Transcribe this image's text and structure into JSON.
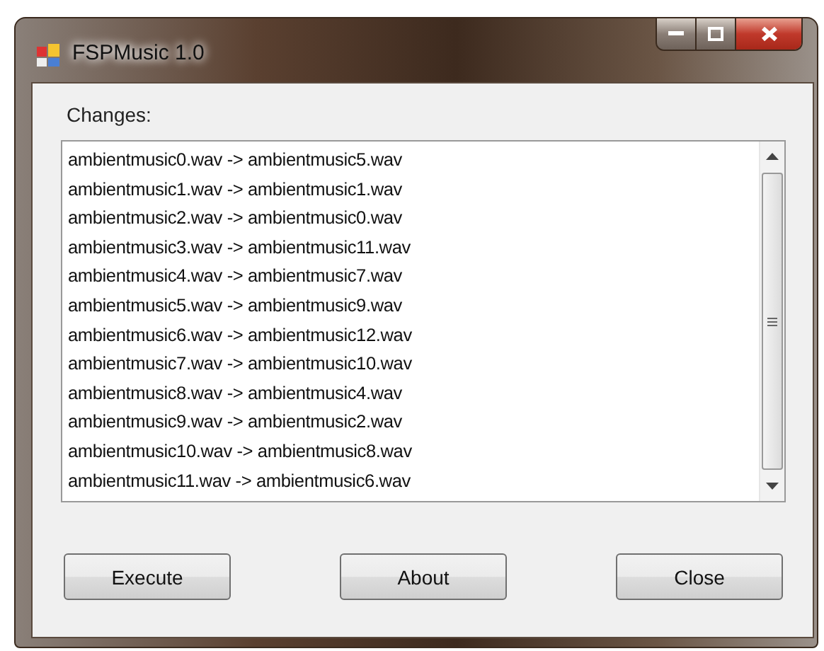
{
  "window": {
    "title": "FSPMusic 1.0"
  },
  "changes": {
    "label": "Changes:",
    "items": [
      "ambientmusic0.wav -> ambientmusic5.wav",
      "ambientmusic1.wav -> ambientmusic1.wav",
      "ambientmusic2.wav -> ambientmusic0.wav",
      "ambientmusic3.wav -> ambientmusic11.wav",
      "ambientmusic4.wav -> ambientmusic7.wav",
      "ambientmusic5.wav -> ambientmusic9.wav",
      "ambientmusic6.wav -> ambientmusic12.wav",
      "ambientmusic7.wav -> ambientmusic10.wav",
      "ambientmusic8.wav -> ambientmusic4.wav",
      "ambientmusic9.wav -> ambientmusic2.wav",
      "ambientmusic10.wav -> ambientmusic8.wav",
      "ambientmusic11.wav -> ambientmusic6.wav"
    ]
  },
  "buttons": [
    "Execute",
    "About",
    "Close"
  ]
}
